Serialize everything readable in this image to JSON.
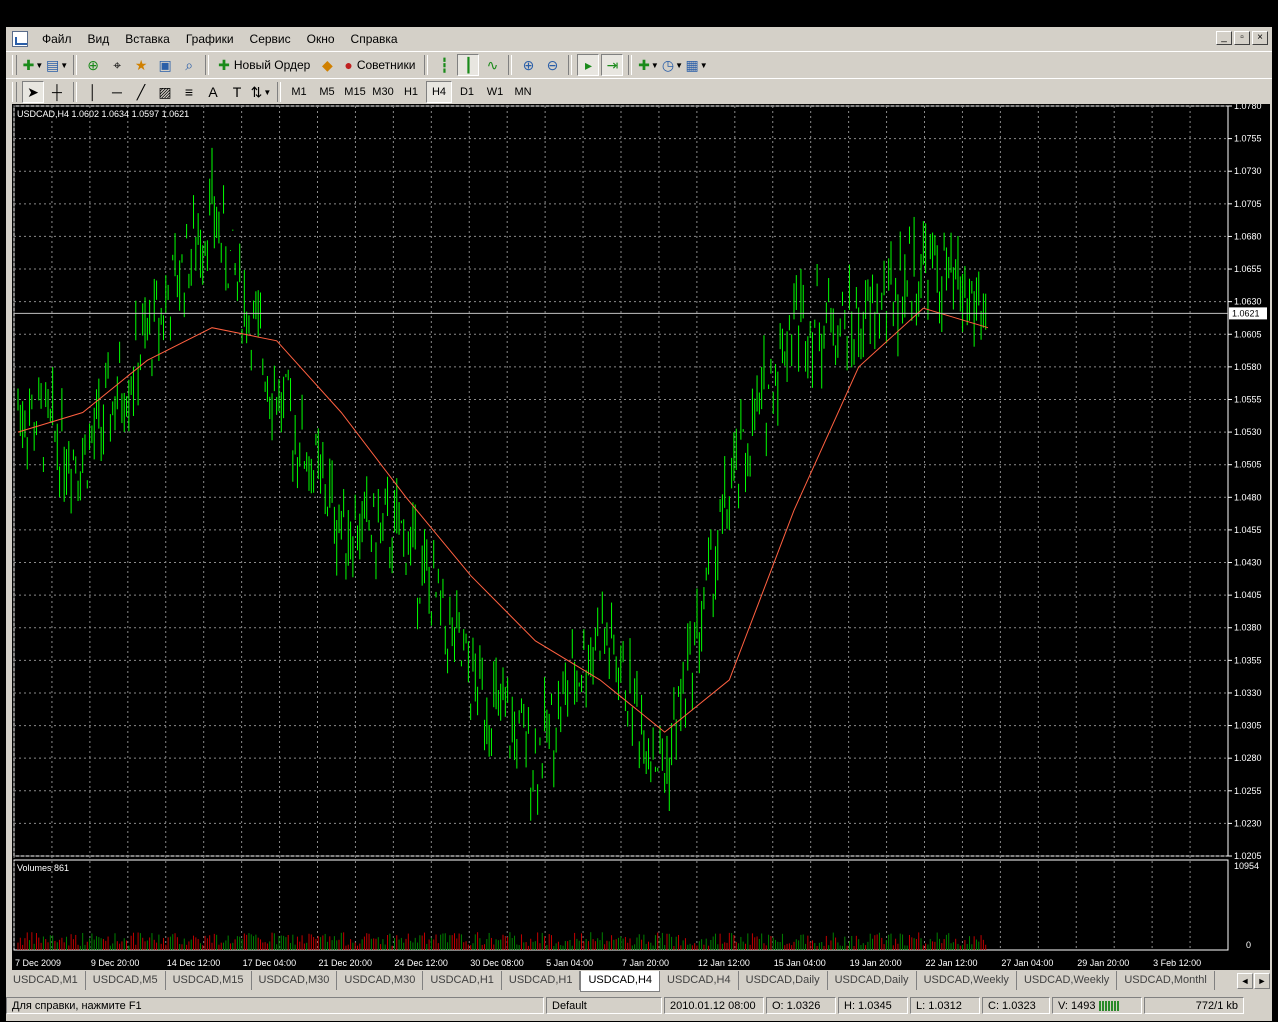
{
  "menubar": {
    "items": [
      "Файл",
      "Вид",
      "Вставка",
      "Графики",
      "Сервис",
      "Окно",
      "Справка"
    ],
    "window_controls": [
      "_",
      "▫",
      "×"
    ]
  },
  "toolbar1": {
    "new_order_label": "Новый Ордер",
    "advisors_label": "Советники"
  },
  "toolbar2": {
    "timeframes": [
      "M1",
      "M5",
      "M15",
      "M30",
      "H1",
      "H4",
      "D1",
      "W1",
      "MN"
    ],
    "active_timeframe": "H4"
  },
  "chart": {
    "symbol_info": "USDCAD,H4  1.0602 1.0634 1.0597 1.0621",
    "volumes_label": "Volumes 861",
    "current_price_label": "1.0621",
    "volume_max_label": "10954",
    "volume_zero_label": "0",
    "colors": {
      "bg": "#000000",
      "grid": "#8a8a8a",
      "candle": "#00ff00",
      "ma": "#ff6040",
      "axis": "#ffffff",
      "volume": "#008000",
      "volume_down": "#c00000"
    }
  },
  "chart_data": {
    "type": "line",
    "series_type": "ohlc-bars (approximated as closing-price path)",
    "ylim": [
      1.0205,
      1.078
    ],
    "y_ticks": [
      "1.0780",
      "1.0755",
      "1.0730",
      "1.0705",
      "1.0680",
      "1.0655",
      "1.0630",
      "1.0605",
      "1.0580",
      "1.0555",
      "1.0530",
      "1.0505",
      "1.0480",
      "1.0455",
      "1.0430",
      "1.0405",
      "1.0380",
      "1.0355",
      "1.0330",
      "1.0305",
      "1.0280",
      "1.0255",
      "1.0230",
      "1.0205"
    ],
    "x_labels": [
      "7 Dec 2009",
      "9 Dec 20:00",
      "14 Dec 12:00",
      "17 Dec 04:00",
      "21 Dec 20:00",
      "24 Dec 12:00",
      "30 Dec 08:00",
      "5 Jan 04:00",
      "7 Jan 20:00",
      "12 Jan 12:00",
      "15 Jan 04:00",
      "19 Jan 20:00",
      "22 Jan 12:00",
      "27 Jan 04:00",
      "29 Jan 20:00",
      "3 Feb 12:00"
    ],
    "x": [
      "7 Dec 2009",
      "9 Dec 20:00",
      "14 Dec 12:00",
      "17 Dec 04:00",
      "21 Dec 20:00",
      "24 Dec 12:00",
      "30 Dec 08:00",
      "5 Jan 04:00",
      "7 Jan 20:00",
      "12 Jan 12:00",
      "15 Jan 04:00",
      "19 Jan 20:00",
      "22 Jan 12:00",
      "27 Jan 04:00",
      "29 Jan 20:00",
      "3 Feb 12:00"
    ],
    "series": [
      {
        "values": [
          1.055,
          1.051,
          1.06,
          1.07,
          1.056,
          1.046,
          1.045,
          1.034,
          1.028,
          1.038,
          1.027,
          1.048,
          1.062,
          1.061,
          1.066,
          1.0621
        ]
      },
      {
        "values": [
          1.053,
          1.0545,
          1.0585,
          1.061,
          1.06,
          1.0545,
          1.048,
          1.042,
          1.037,
          1.034,
          1.03,
          1.034,
          1.047,
          1.058,
          1.0625,
          1.061
        ]
      }
    ],
    "grid": true,
    "current_price": 1.0621
  },
  "tabs": {
    "items": [
      "USDCAD,M1",
      "USDCAD,M5",
      "USDCAD,M15",
      "USDCAD,M30",
      "USDCAD,M30",
      "USDCAD,H1",
      "USDCAD,H1",
      "USDCAD,H4",
      "USDCAD,H4",
      "USDCAD,Daily",
      "USDCAD,Daily",
      "USDCAD,Weekly",
      "USDCAD,Weekly",
      "USDCAD,Monthl"
    ],
    "active_index": 7,
    "nav": [
      "◄",
      "►"
    ]
  },
  "status": {
    "help": "Для справки, нажмите F1",
    "profile": "Default",
    "datetime": "2010.01.12 08:00",
    "open": "O: 1.0326",
    "high": "H: 1.0345",
    "low": "L: 1.0312",
    "close": "C: 1.0323",
    "volume": "V: 1493",
    "traffic": "772/1 kb"
  }
}
